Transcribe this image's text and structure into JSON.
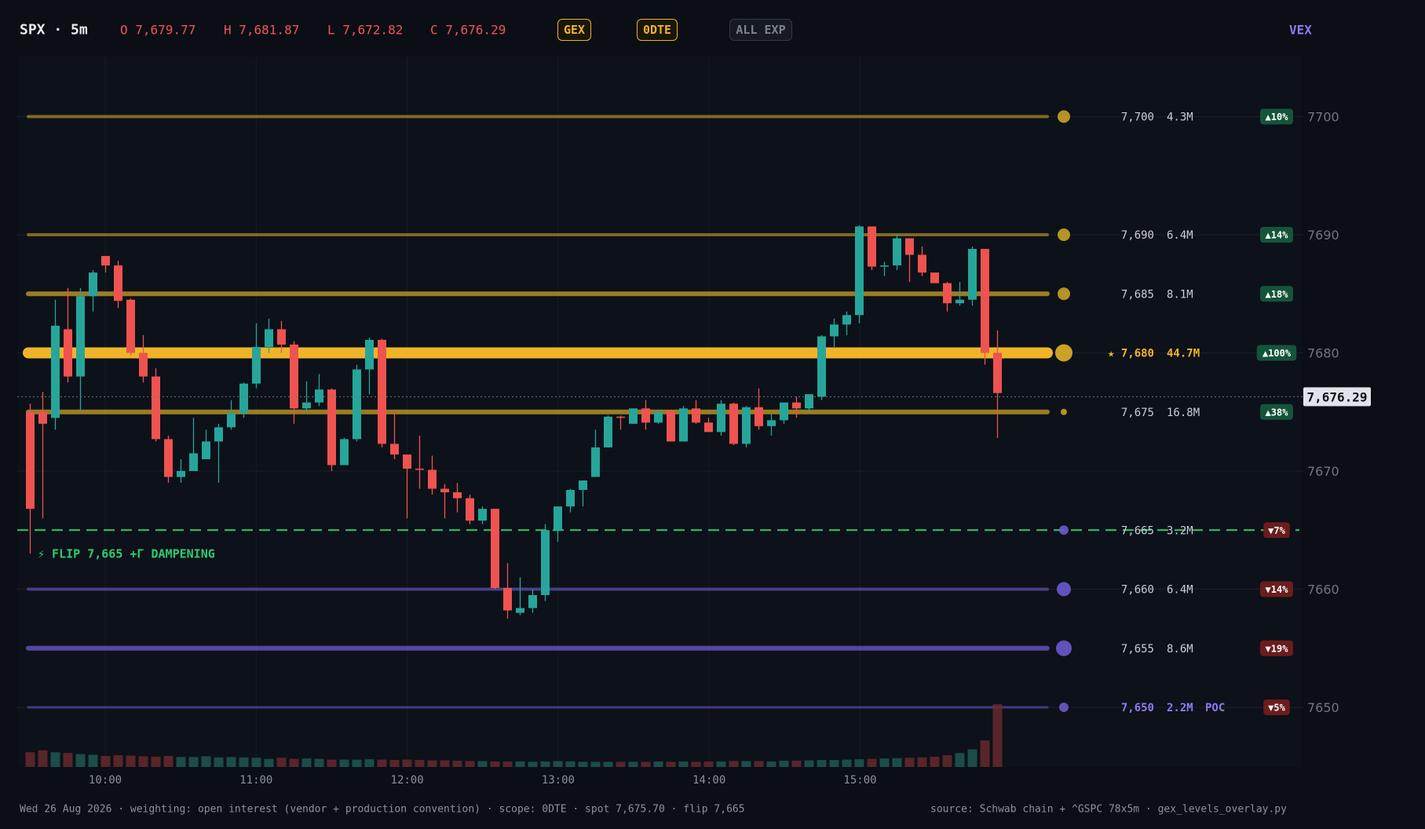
{
  "header": {
    "symbol": "SPX · 5m",
    "open": "O 7,679.77",
    "high": "H 7,681.87",
    "low": "L 7,672.82",
    "close": "C 7,676.29",
    "pills": [
      {
        "label": "GEX",
        "active": true
      },
      {
        "label": "0DTE",
        "active": true
      },
      {
        "label": "ALL EXP",
        "active": false
      }
    ],
    "vex_label": "VEX"
  },
  "flip_annotation": "⚡ FLIP 7,665  +Γ DAMPENING",
  "spot_tag": "7,676.29",
  "footer": {
    "left": "Wed 26 Aug 2026  ·  weighting: open interest (vendor + production convention)  ·  scope: 0DTE  ·  spot 7,675.70  ·  flip 7,665",
    "right": "source: Schwab chain + ^GSPC 78x5m  ·  gex_levels_overlay.py"
  },
  "colors": {
    "background": "#0b0e15",
    "up": "#26a69a",
    "down": "#ef5350",
    "call_wall": "#c9a227",
    "top_wall": "#f0b429",
    "put_wall": "#6a5acd",
    "flip": "#2ecc71",
    "poc": "#8b7cf6"
  },
  "chart_data": {
    "type": "candlestick",
    "ylim": [
      7645,
      7705
    ],
    "y_ticks": [
      7650,
      7660,
      7670,
      7680,
      7690,
      7700
    ],
    "x_ticks": [
      "10:00",
      "11:00",
      "12:00",
      "13:00",
      "14:00",
      "15:00"
    ],
    "spot": 7676.29,
    "flip": 7665,
    "levels": [
      {
        "strike": 7700,
        "label": "7,700",
        "gex": "4.3M",
        "pct": "▲10%",
        "side": "call"
      },
      {
        "strike": 7690,
        "label": "7,690",
        "gex": "6.4M",
        "pct": "▲14%",
        "side": "call"
      },
      {
        "strike": 7685,
        "label": "7,685",
        "gex": "8.1M",
        "pct": "▲18%",
        "side": "call"
      },
      {
        "strike": 7680,
        "label": "★ 7,680",
        "gex": "44.7M",
        "pct": "▲100%",
        "side": "call",
        "top": true
      },
      {
        "strike": 7675,
        "label": "7,675",
        "gex": "16.8M",
        "pct": "▲38%",
        "side": "call"
      },
      {
        "strike": 7665,
        "label": "7,665",
        "gex": "3.2M",
        "pct": "▼7%",
        "side": "put",
        "flip": true
      },
      {
        "strike": 7660,
        "label": "7,660",
        "gex": "6.4M",
        "pct": "▼14%",
        "side": "put"
      },
      {
        "strike": 7655,
        "label": "7,655",
        "gex": "8.6M",
        "pct": "▼19%",
        "side": "put"
      },
      {
        "strike": 7650,
        "label": "7,650",
        "gex": "2.2M",
        "pct": "▼5%",
        "side": "put",
        "poc": "POC"
      }
    ],
    "candles": [
      [
        7675.0,
        7675.7,
        7663.0,
        7666.8
      ],
      [
        7675.0,
        7676.7,
        7666.0,
        7674.0
      ],
      [
        7674.5,
        7684.5,
        7673.5,
        7682.3
      ],
      [
        7682.0,
        7685.5,
        7677.5,
        7678.0
      ],
      [
        7678.0,
        7685.5,
        7675.0,
        7684.8
      ],
      [
        7684.8,
        7687.0,
        7683.5,
        7686.8
      ],
      [
        7688.2,
        7688.2,
        7686.8,
        7687.4
      ],
      [
        7687.4,
        7687.8,
        7683.8,
        7684.4
      ],
      [
        7684.5,
        7684.6,
        7679.8,
        7680.0
      ],
      [
        7680.0,
        7681.5,
        7677.5,
        7678.0
      ],
      [
        7678.0,
        7678.7,
        7672.5,
        7672.7
      ],
      [
        7672.7,
        7673.0,
        7669.0,
        7669.5
      ],
      [
        7669.5,
        7671.0,
        7669.0,
        7670.0
      ],
      [
        7670.0,
        7674.5,
        7670.0,
        7671.5
      ],
      [
        7671.0,
        7673.5,
        7671.0,
        7672.5
      ],
      [
        7672.5,
        7674.0,
        7669.0,
        7673.7
      ],
      [
        7673.7,
        7676.0,
        7673.5,
        7674.9
      ],
      [
        7674.9,
        7677.5,
        7674.5,
        7677.4
      ],
      [
        7677.4,
        7682.5,
        7677.0,
        7680.5
      ],
      [
        7680.5,
        7682.9,
        7680.0,
        7682.0
      ],
      [
        7682.0,
        7682.7,
        7680.0,
        7680.7
      ],
      [
        7680.7,
        7681.0,
        7674.0,
        7675.3
      ],
      [
        7675.3,
        7677.6,
        7675.0,
        7675.8
      ],
      [
        7675.8,
        7678.2,
        7675.5,
        7676.9
      ],
      [
        7676.9,
        7677.0,
        7670.0,
        7670.5
      ],
      [
        7670.5,
        7672.8,
        7670.5,
        7672.7
      ],
      [
        7672.7,
        7679.0,
        7672.5,
        7678.6
      ],
      [
        7678.6,
        7681.3,
        7676.5,
        7681.1
      ],
      [
        7681.1,
        7681.2,
        7672.0,
        7672.3
      ],
      [
        7672.3,
        7675.0,
        7671.0,
        7671.4
      ],
      [
        7671.4,
        7671.4,
        7666.0,
        7670.2
      ],
      [
        7670.2,
        7673.0,
        7668.5,
        7670.1
      ],
      [
        7670.1,
        7671.3,
        7668.0,
        7668.5
      ],
      [
        7668.5,
        7668.9,
        7666.0,
        7668.2
      ],
      [
        7668.2,
        7669.0,
        7666.5,
        7667.7
      ],
      [
        7667.7,
        7668.0,
        7665.5,
        7665.8
      ],
      [
        7665.8,
        7667.0,
        7665.5,
        7666.8
      ],
      [
        7666.8,
        7666.8,
        7660.0,
        7660.1
      ],
      [
        7660.1,
        7662.2,
        7657.5,
        7658.2
      ],
      [
        7658.0,
        7661.0,
        7657.8,
        7658.4
      ],
      [
        7658.4,
        7660.0,
        7658.0,
        7659.5
      ],
      [
        7659.5,
        7665.5,
        7659.0,
        7665.0
      ],
      [
        7665.0,
        7667.0,
        7664.0,
        7667.0
      ],
      [
        7667.0,
        7668.5,
        7666.5,
        7668.4
      ],
      [
        7668.4,
        7669.0,
        7667.0,
        7669.2
      ],
      [
        7669.5,
        7673.5,
        7669.5,
        7672.0
      ],
      [
        7672.0,
        7674.7,
        7672.0,
        7674.6
      ],
      [
        7674.6,
        7674.7,
        7673.5,
        7674.5
      ],
      [
        7674.0,
        7675.2,
        7674.0,
        7675.3
      ],
      [
        7675.3,
        7676.0,
        7673.5,
        7674.1
      ],
      [
        7674.1,
        7675.2,
        7674.0,
        7675.0
      ],
      [
        7675.1,
        7675.2,
        7672.5,
        7672.5
      ],
      [
        7672.5,
        7675.5,
        7672.5,
        7675.3
      ],
      [
        7675.3,
        7676.0,
        7674.0,
        7674.1
      ],
      [
        7674.1,
        7674.5,
        7673.5,
        7673.3
      ],
      [
        7673.3,
        7676.0,
        7673.0,
        7675.7
      ],
      [
        7675.7,
        7675.8,
        7672.2,
        7672.3
      ],
      [
        7672.3,
        7675.5,
        7672.0,
        7675.4
      ],
      [
        7675.4,
        7677.0,
        7673.5,
        7673.8
      ],
      [
        7673.8,
        7674.8,
        7673.0,
        7674.3
      ],
      [
        7674.3,
        7675.8,
        7674.0,
        7675.8
      ],
      [
        7675.8,
        7676.3,
        7674.5,
        7675.3
      ],
      [
        7675.3,
        7676.5,
        7675.0,
        7676.5
      ],
      [
        7676.3,
        7681.5,
        7676.0,
        7681.4
      ],
      [
        7681.4,
        7682.9,
        7680.5,
        7682.4
      ],
      [
        7682.4,
        7683.5,
        7681.5,
        7683.2
      ],
      [
        7683.2,
        7690.8,
        7682.5,
        7690.7
      ],
      [
        7690.7,
        7690.7,
        7687.0,
        7687.3
      ],
      [
        7687.3,
        7687.7,
        7686.5,
        7687.4
      ],
      [
        7687.4,
        7690.0,
        7687.0,
        7689.7
      ],
      [
        7689.7,
        7689.5,
        7686.0,
        7688.3
      ],
      [
        7688.3,
        7689.0,
        7686.5,
        7686.8
      ],
      [
        7686.8,
        7686.2,
        7686.0,
        7685.9
      ],
      [
        7685.9,
        7686.0,
        7683.5,
        7684.2
      ],
      [
        7684.2,
        7686.0,
        7684.0,
        7684.5
      ],
      [
        7684.5,
        7689.0,
        7684.0,
        7688.8
      ],
      [
        7688.8,
        7688.8,
        7679.0,
        7680.0
      ],
      [
        7680.0,
        7681.9,
        7672.8,
        7676.6
      ]
    ],
    "volume": [
      40,
      45,
      40,
      38,
      35,
      33,
      30,
      32,
      31,
      29,
      28,
      30,
      27,
      27,
      29,
      26,
      27,
      26,
      25,
      22,
      25,
      22,
      23,
      22,
      20,
      20,
      20,
      21,
      20,
      19,
      20,
      19,
      18,
      18,
      17,
      16,
      16,
      15,
      15,
      15,
      14,
      15,
      16,
      15,
      14,
      14,
      14,
      14,
      14,
      14,
      15,
      14,
      15,
      14,
      15,
      15,
      16,
      16,
      16,
      15,
      17,
      17,
      18,
      19,
      19,
      20,
      21,
      22,
      23,
      24,
      25,
      26,
      28,
      32,
      38,
      48,
      72,
      170
    ]
  }
}
